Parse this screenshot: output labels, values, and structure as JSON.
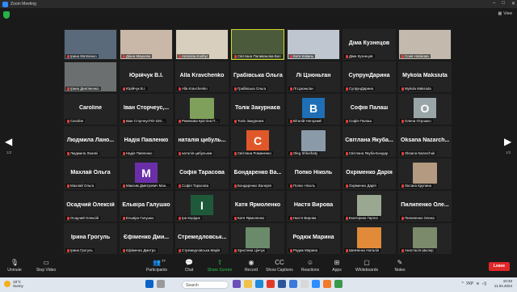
{
  "window": {
    "title": "Zoom Meeting"
  },
  "view": {
    "label": "View"
  },
  "page": {
    "left": "1/2",
    "right": "1/2"
  },
  "tiles": [
    {
      "name": "Ірина Матвієнко",
      "big": "",
      "type": "video",
      "color": "#5a6a7a"
    },
    {
      "name": "Діана Маркова",
      "big": "",
      "type": "video",
      "color": "#c9b8a8"
    },
    {
      "name": "Antonina Kushyr",
      "big": "",
      "type": "video",
      "color": "#d8cfbf"
    },
    {
      "name": "Світлана Паливанова-Бел",
      "big": "",
      "type": "video",
      "color": "#4a5a3a",
      "active": true
    },
    {
      "name": "Катя Ковань",
      "big": "",
      "type": "video",
      "color": "#bfc6cf"
    },
    {
      "name": "Діма Кузнецов",
      "big": "Діма Кузнецов",
      "type": "text"
    },
    {
      "name": "Соня Новікова",
      "big": "",
      "type": "video",
      "color": "#c3b9ad"
    },
    {
      "name": "Ірина Дем'яненко",
      "big": "",
      "type": "video",
      "color": "#6b6f70"
    },
    {
      "name": "Юрійчук В.І.",
      "big": "Юрійчук В.І.",
      "type": "text"
    },
    {
      "name": "Alla Kravchenko",
      "big": "Alla Kravchenko",
      "type": "text"
    },
    {
      "name": "Грабівська Ольга",
      "big": "Грабівська Ольга",
      "type": "text"
    },
    {
      "name": "Лі Цзюньтан",
      "big": "Лі Цзюньтан",
      "type": "text"
    },
    {
      "name": "СупрунДарина",
      "big": "СупрунДарина",
      "type": "text"
    },
    {
      "name": "Mykola Maksiuta",
      "big": "Mykola Maksiuta",
      "type": "text"
    },
    {
      "name": "Caroline",
      "big": "Caroline",
      "type": "text"
    },
    {
      "name": "Іван СторчеусПО-220...",
      "big": "Іван Сторчеус,...",
      "type": "text"
    },
    {
      "name": "Ржевкова Крістіна П...",
      "big": "",
      "type": "photo",
      "color": "#7fa05a"
    },
    {
      "name": "Толік Закурнаєв",
      "big": "Толік Закурнаєв",
      "type": "text"
    },
    {
      "name": "Віталій Негорний",
      "big": "",
      "type": "avatar",
      "letter": "B",
      "color": "#1e6fb5"
    },
    {
      "name": "Софія Палаш",
      "big": "Софія Палаш",
      "type": "text"
    },
    {
      "name": "Олена Отрошко",
      "big": "",
      "type": "avatar",
      "letter": "O",
      "color": "#9aa5a8"
    },
    {
      "name": "Людмила Ланові",
      "big": "Людмила Лано...",
      "type": "text"
    },
    {
      "name": "Надія Павленко",
      "big": "Надія Павленко",
      "type": "text"
    },
    {
      "name": "наталія цибульник",
      "big": "наталія цибуль...",
      "type": "text"
    },
    {
      "name": "Світлана Романенко",
      "big": "",
      "type": "avatar",
      "letter": "C",
      "color": "#e0582a"
    },
    {
      "name": "Oleg Shkorbaty",
      "big": "",
      "type": "photo",
      "color": "#8a9aa8"
    },
    {
      "name": "Світлана Якуба-Бондар",
      "big": "Світлана Якуба...",
      "type": "text"
    },
    {
      "name": "Oksana Nazarchuk",
      "big": "Oksana Nazarch...",
      "type": "text"
    },
    {
      "name": "Махлай Ольга",
      "big": "Махлай Ольга",
      "type": "text"
    },
    {
      "name": "Максим Дмитрович Ман...",
      "big": "",
      "type": "avatar",
      "letter": "M",
      "color": "#6a2fa8"
    },
    {
      "name": "Софія Тарасова",
      "big": "Софія Тарасова",
      "type": "text"
    },
    {
      "name": "Бондаренко Валерія",
      "big": "Бондаренко Ва...",
      "type": "text"
    },
    {
      "name": "Попко Ніколь",
      "big": "Попко Ніколь",
      "type": "text"
    },
    {
      "name": "Охріменко Дарія",
      "big": "Охріменко Дарія",
      "type": "text"
    },
    {
      "name": "Оксана Крупина",
      "big": "",
      "type": "photo",
      "color": "#b49a80"
    },
    {
      "name": "Осадчий Олексій",
      "big": "Осадчий Олексій",
      "type": "text"
    },
    {
      "name": "Ельвіра Галушко",
      "big": "Ельвіра Галушко",
      "type": "text"
    },
    {
      "name": "Іра Корідик",
      "big": "",
      "type": "avatar",
      "letter": "I",
      "color": "#1e5a3a"
    },
    {
      "name": "Катя Ярмоленко",
      "big": "Катя Ярмоленко",
      "type": "text"
    },
    {
      "name": "Настя Вирова",
      "big": "Настя Вирова",
      "type": "text"
    },
    {
      "name": "Екатерина Гиргиз",
      "big": "",
      "type": "photo",
      "color": "#9aa892"
    },
    {
      "name": "Пилипенко Олена",
      "big": "Пилипенко Оле...",
      "type": "text"
    },
    {
      "name": "Ірина Грогуль",
      "big": "Ірина Грогуль",
      "type": "text"
    },
    {
      "name": "Єфіменко Дмитро",
      "big": "Єфіменко Дми...",
      "type": "text"
    },
    {
      "name": "Стремедловська Марія",
      "big": "Стремедловськ...",
      "type": "text"
    },
    {
      "name": "Христина Цінчук",
      "big": "",
      "type": "photo",
      "color": "#6a8a6a"
    },
    {
      "name": "Родюк Марина",
      "big": "Родюк Марина",
      "type": "text"
    },
    {
      "name": "Шевченко Наталія",
      "big": "",
      "type": "photo",
      "color": "#e08a3a"
    },
    {
      "name": "Анастасія Шкоїер",
      "big": "",
      "type": "photo",
      "color": "#7a8a6a"
    }
  ],
  "toolbar": {
    "unmute": "Unmute",
    "stop_video": "Stop Video",
    "participants": "Participants",
    "participants_count": "77",
    "chat": "Chat",
    "share_screen": "Share Screen",
    "record": "Record",
    "show_captions": "Show Captions",
    "reactions": "Reactions",
    "apps": "Apps",
    "whiteboards": "Whiteboards",
    "notes": "Notes",
    "leave": "Leave"
  },
  "taskbar": {
    "temp": "18°C",
    "weather": "Sunny",
    "search_placeholder": "Search",
    "lang": "УКР",
    "time": "10:33",
    "date": "11.04.2024"
  },
  "colors": {
    "accent_green": "#26c24a",
    "leave_red": "#e02828",
    "active_border": "#d6d92a"
  }
}
